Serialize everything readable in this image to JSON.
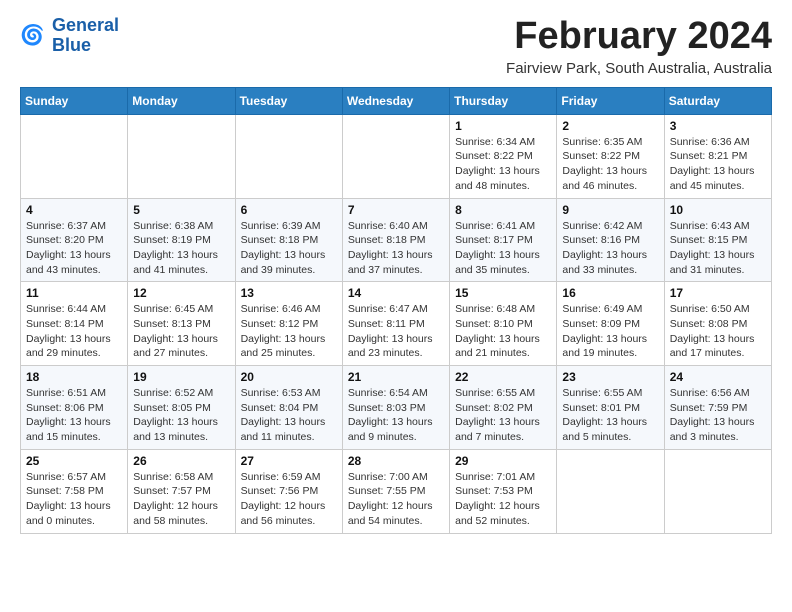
{
  "logo": {
    "line1": "General",
    "line2": "Blue"
  },
  "title": "February 2024",
  "location": "Fairview Park, South Australia, Australia",
  "days_of_week": [
    "Sunday",
    "Monday",
    "Tuesday",
    "Wednesday",
    "Thursday",
    "Friday",
    "Saturday"
  ],
  "weeks": [
    [
      {
        "day": "",
        "info": ""
      },
      {
        "day": "",
        "info": ""
      },
      {
        "day": "",
        "info": ""
      },
      {
        "day": "",
        "info": ""
      },
      {
        "day": "1",
        "info": "Sunrise: 6:34 AM\nSunset: 8:22 PM\nDaylight: 13 hours\nand 48 minutes."
      },
      {
        "day": "2",
        "info": "Sunrise: 6:35 AM\nSunset: 8:22 PM\nDaylight: 13 hours\nand 46 minutes."
      },
      {
        "day": "3",
        "info": "Sunrise: 6:36 AM\nSunset: 8:21 PM\nDaylight: 13 hours\nand 45 minutes."
      }
    ],
    [
      {
        "day": "4",
        "info": "Sunrise: 6:37 AM\nSunset: 8:20 PM\nDaylight: 13 hours\nand 43 minutes."
      },
      {
        "day": "5",
        "info": "Sunrise: 6:38 AM\nSunset: 8:19 PM\nDaylight: 13 hours\nand 41 minutes."
      },
      {
        "day": "6",
        "info": "Sunrise: 6:39 AM\nSunset: 8:18 PM\nDaylight: 13 hours\nand 39 minutes."
      },
      {
        "day": "7",
        "info": "Sunrise: 6:40 AM\nSunset: 8:18 PM\nDaylight: 13 hours\nand 37 minutes."
      },
      {
        "day": "8",
        "info": "Sunrise: 6:41 AM\nSunset: 8:17 PM\nDaylight: 13 hours\nand 35 minutes."
      },
      {
        "day": "9",
        "info": "Sunrise: 6:42 AM\nSunset: 8:16 PM\nDaylight: 13 hours\nand 33 minutes."
      },
      {
        "day": "10",
        "info": "Sunrise: 6:43 AM\nSunset: 8:15 PM\nDaylight: 13 hours\nand 31 minutes."
      }
    ],
    [
      {
        "day": "11",
        "info": "Sunrise: 6:44 AM\nSunset: 8:14 PM\nDaylight: 13 hours\nand 29 minutes."
      },
      {
        "day": "12",
        "info": "Sunrise: 6:45 AM\nSunset: 8:13 PM\nDaylight: 13 hours\nand 27 minutes."
      },
      {
        "day": "13",
        "info": "Sunrise: 6:46 AM\nSunset: 8:12 PM\nDaylight: 13 hours\nand 25 minutes."
      },
      {
        "day": "14",
        "info": "Sunrise: 6:47 AM\nSunset: 8:11 PM\nDaylight: 13 hours\nand 23 minutes."
      },
      {
        "day": "15",
        "info": "Sunrise: 6:48 AM\nSunset: 8:10 PM\nDaylight: 13 hours\nand 21 minutes."
      },
      {
        "day": "16",
        "info": "Sunrise: 6:49 AM\nSunset: 8:09 PM\nDaylight: 13 hours\nand 19 minutes."
      },
      {
        "day": "17",
        "info": "Sunrise: 6:50 AM\nSunset: 8:08 PM\nDaylight: 13 hours\nand 17 minutes."
      }
    ],
    [
      {
        "day": "18",
        "info": "Sunrise: 6:51 AM\nSunset: 8:06 PM\nDaylight: 13 hours\nand 15 minutes."
      },
      {
        "day": "19",
        "info": "Sunrise: 6:52 AM\nSunset: 8:05 PM\nDaylight: 13 hours\nand 13 minutes."
      },
      {
        "day": "20",
        "info": "Sunrise: 6:53 AM\nSunset: 8:04 PM\nDaylight: 13 hours\nand 11 minutes."
      },
      {
        "day": "21",
        "info": "Sunrise: 6:54 AM\nSunset: 8:03 PM\nDaylight: 13 hours\nand 9 minutes."
      },
      {
        "day": "22",
        "info": "Sunrise: 6:55 AM\nSunset: 8:02 PM\nDaylight: 13 hours\nand 7 minutes."
      },
      {
        "day": "23",
        "info": "Sunrise: 6:55 AM\nSunset: 8:01 PM\nDaylight: 13 hours\nand 5 minutes."
      },
      {
        "day": "24",
        "info": "Sunrise: 6:56 AM\nSunset: 7:59 PM\nDaylight: 13 hours\nand 3 minutes."
      }
    ],
    [
      {
        "day": "25",
        "info": "Sunrise: 6:57 AM\nSunset: 7:58 PM\nDaylight: 13 hours\nand 0 minutes."
      },
      {
        "day": "26",
        "info": "Sunrise: 6:58 AM\nSunset: 7:57 PM\nDaylight: 12 hours\nand 58 minutes."
      },
      {
        "day": "27",
        "info": "Sunrise: 6:59 AM\nSunset: 7:56 PM\nDaylight: 12 hours\nand 56 minutes."
      },
      {
        "day": "28",
        "info": "Sunrise: 7:00 AM\nSunset: 7:55 PM\nDaylight: 12 hours\nand 54 minutes."
      },
      {
        "day": "29",
        "info": "Sunrise: 7:01 AM\nSunset: 7:53 PM\nDaylight: 12 hours\nand 52 minutes."
      },
      {
        "day": "",
        "info": ""
      },
      {
        "day": "",
        "info": ""
      }
    ]
  ]
}
